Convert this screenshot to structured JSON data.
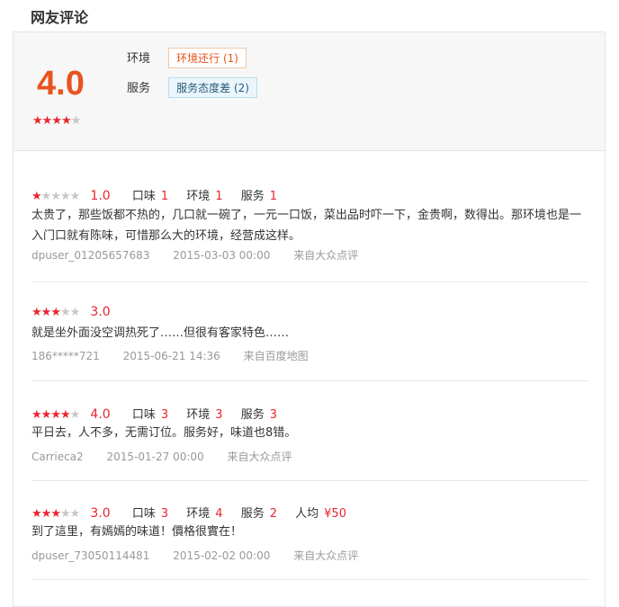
{
  "section_title": "网友评论",
  "summary": {
    "score": "4.0",
    "stars_filled": 4,
    "stars_total": 5,
    "aspects": [
      {
        "label": "环境",
        "tag": "环境还行 (1)",
        "tag_color": "#e8541e"
      },
      {
        "label": "服务",
        "tag": "服务态度差 (2)",
        "tag_color": "#2a5a7a"
      }
    ]
  },
  "colors": {
    "accent_red": "#e8262e",
    "score_orange": "#e8541e",
    "muted": "#999999"
  },
  "reviews": [
    {
      "stars_filled": 1,
      "score": "1.0",
      "sub": [
        {
          "label": "口味",
          "value": "1"
        },
        {
          "label": "环境",
          "value": "1"
        },
        {
          "label": "服务",
          "value": "1"
        }
      ],
      "text": "太贵了，那些饭都不热的，几口就一碗了，一元一口饭，菜出品时吓一下，金贵啊，数得出。那环境也是一入门口就有陈味，可惜那么大的环境，经营成这样。",
      "user": "dpuser_01205657683",
      "date": "2015-03-03 00:00",
      "source": "来自大众点评"
    },
    {
      "stars_filled": 3,
      "score": "3.0",
      "sub": [],
      "text": "就是坐外面没空调热死了……但很有客家特色……",
      "user": "186*****721",
      "date": "2015-06-21 14:36",
      "source": "来自百度地图"
    },
    {
      "stars_filled": 4,
      "score": "4.0",
      "sub": [
        {
          "label": "口味",
          "value": "3"
        },
        {
          "label": "环境",
          "value": "3"
        },
        {
          "label": "服务",
          "value": "3"
        }
      ],
      "text": "平日去，人不多，无需订位。服务好，味道也8错。",
      "user": "Carrieca2",
      "date": "2015-01-27 00:00",
      "source": "来自大众点评"
    },
    {
      "stars_filled": 3,
      "score": "3.0",
      "sub": [
        {
          "label": "口味",
          "value": "3"
        },
        {
          "label": "环境",
          "value": "4"
        },
        {
          "label": "服务",
          "value": "2"
        },
        {
          "label": "人均",
          "value": "¥50"
        }
      ],
      "text": "到了這里，有嫣嫣的味道！價格很實在！",
      "user": "dpuser_73050114481",
      "date": "2015-02-02 00:00",
      "source": "来自大众点评"
    }
  ]
}
